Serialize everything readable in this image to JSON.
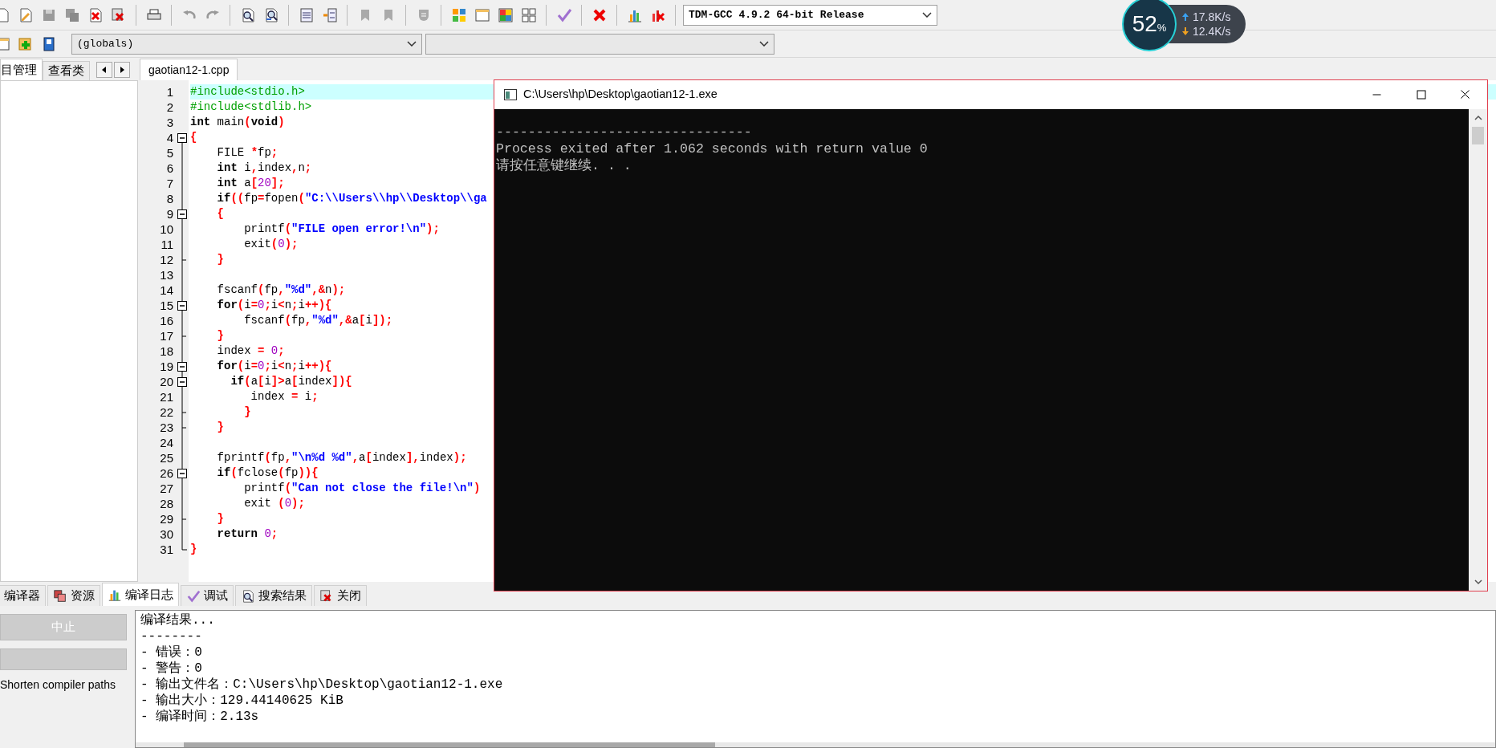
{
  "toolbar": {
    "compiler": "TDM-GCC 4.9.2 64-bit Release",
    "scope": "(globals)"
  },
  "project_panel": {
    "tabs": [
      {
        "label": "目管理",
        "selected": true
      },
      {
        "label": "查看类",
        "selected": false
      }
    ]
  },
  "editor": {
    "tabs": [
      {
        "label": "gaotian12-1.cpp",
        "selected": true
      }
    ],
    "lines": [
      {
        "number": "1",
        "current": true,
        "tokens": [
          {
            "kind": "preprocessor",
            "text": "#include<stdio.h>"
          }
        ]
      },
      {
        "number": "2",
        "current": false,
        "tokens": [
          {
            "kind": "preprocessor",
            "text": "#include<stdlib.h>"
          }
        ]
      },
      {
        "number": "3",
        "current": false,
        "tokens": [
          {
            "kind": "keyword",
            "text": "int"
          },
          {
            "kind": "text",
            "text": " main"
          },
          {
            "kind": "symbol",
            "text": "("
          },
          {
            "kind": "keyword",
            "text": "void"
          },
          {
            "kind": "symbol",
            "text": ")"
          }
        ]
      },
      {
        "number": "4",
        "current": false,
        "kind": "open",
        "tokens": [
          {
            "kind": "symbol",
            "text": "{"
          }
        ]
      },
      {
        "number": "5",
        "current": false,
        "kind": "line",
        "tokens": [
          {
            "kind": "text",
            "text": "    FILE "
          },
          {
            "kind": "symbol",
            "text": "*"
          },
          {
            "kind": "text",
            "text": "fp"
          },
          {
            "kind": "symbol",
            "text": ";"
          }
        ]
      },
      {
        "number": "6",
        "current": false,
        "kind": "line",
        "tokens": [
          {
            "kind": "keyword",
            "text": "    int"
          },
          {
            "kind": "text",
            "text": " i"
          },
          {
            "kind": "symbol",
            "text": ","
          },
          {
            "kind": "text",
            "text": "index"
          },
          {
            "kind": "symbol",
            "text": ","
          },
          {
            "kind": "text",
            "text": "n"
          },
          {
            "kind": "symbol",
            "text": ";"
          }
        ]
      },
      {
        "number": "7",
        "current": false,
        "kind": "line",
        "tokens": [
          {
            "kind": "keyword",
            "text": "    int"
          },
          {
            "kind": "text",
            "text": " a"
          },
          {
            "kind": "symbol",
            "text": "["
          },
          {
            "kind": "number",
            "text": "20"
          },
          {
            "kind": "symbol",
            "text": "];"
          }
        ]
      },
      {
        "number": "8",
        "current": false,
        "kind": "line",
        "tokens": [
          {
            "kind": "keyword",
            "text": "    if"
          },
          {
            "kind": "symbol",
            "text": "(("
          },
          {
            "kind": "text",
            "text": "fp"
          },
          {
            "kind": "symbol",
            "text": "="
          },
          {
            "kind": "text",
            "text": "fopen"
          },
          {
            "kind": "symbol",
            "text": "("
          },
          {
            "kind": "string",
            "text": "\"C:\\\\Users\\\\hp\\\\Desktop\\\\ga"
          }
        ]
      },
      {
        "number": "9",
        "current": false,
        "kind": "open",
        "tokens": [
          {
            "kind": "symbol",
            "text": "    {"
          }
        ]
      },
      {
        "number": "10",
        "current": false,
        "kind": "line",
        "tokens": [
          {
            "kind": "text",
            "text": "        printf"
          },
          {
            "kind": "symbol",
            "text": "("
          },
          {
            "kind": "string",
            "text": "\"FILE open error!\\n\""
          },
          {
            "kind": "symbol",
            "text": ");"
          }
        ]
      },
      {
        "number": "11",
        "current": false,
        "kind": "line",
        "tokens": [
          {
            "kind": "text",
            "text": "        exit"
          },
          {
            "kind": "symbol",
            "text": "("
          },
          {
            "kind": "number",
            "text": "0"
          },
          {
            "kind": "symbol",
            "text": ");"
          }
        ]
      },
      {
        "number": "12",
        "current": false,
        "kind": "end",
        "tokens": [
          {
            "kind": "symbol",
            "text": "    }"
          }
        ]
      },
      {
        "number": "13",
        "current": false,
        "kind": "line"
      },
      {
        "number": "14",
        "current": false,
        "kind": "line",
        "tokens": [
          {
            "kind": "text",
            "text": "    fscanf"
          },
          {
            "kind": "symbol",
            "text": "("
          },
          {
            "kind": "text",
            "text": "fp"
          },
          {
            "kind": "symbol",
            "text": ","
          },
          {
            "kind": "string",
            "text": "\"%d\""
          },
          {
            "kind": "symbol",
            "text": ",&"
          },
          {
            "kind": "text",
            "text": "n"
          },
          {
            "kind": "symbol",
            "text": ");"
          }
        ]
      },
      {
        "number": "15",
        "current": false,
        "kind": "open",
        "tokens": [
          {
            "kind": "keyword",
            "text": "    for"
          },
          {
            "kind": "symbol",
            "text": "("
          },
          {
            "kind": "text",
            "text": "i"
          },
          {
            "kind": "symbol",
            "text": "="
          },
          {
            "kind": "number",
            "text": "0"
          },
          {
            "kind": "symbol",
            "text": ";"
          },
          {
            "kind": "text",
            "text": "i"
          },
          {
            "kind": "symbol",
            "text": "<"
          },
          {
            "kind": "text",
            "text": "n"
          },
          {
            "kind": "symbol",
            "text": ";"
          },
          {
            "kind": "text",
            "text": "i"
          },
          {
            "kind": "symbol",
            "text": "++){"
          }
        ]
      },
      {
        "number": "16",
        "current": false,
        "kind": "line",
        "tokens": [
          {
            "kind": "text",
            "text": "        fscanf"
          },
          {
            "kind": "symbol",
            "text": "("
          },
          {
            "kind": "text",
            "text": "fp"
          },
          {
            "kind": "symbol",
            "text": ","
          },
          {
            "kind": "string",
            "text": "\"%d\""
          },
          {
            "kind": "symbol",
            "text": ",&"
          },
          {
            "kind": "text",
            "text": "a"
          },
          {
            "kind": "symbol",
            "text": "["
          },
          {
            "kind": "text",
            "text": "i"
          },
          {
            "kind": "symbol",
            "text": "]);"
          }
        ]
      },
      {
        "number": "17",
        "current": false,
        "kind": "end",
        "tokens": [
          {
            "kind": "symbol",
            "text": "    }"
          }
        ]
      },
      {
        "number": "18",
        "current": false,
        "kind": "line",
        "tokens": [
          {
            "kind": "text",
            "text": "    index "
          },
          {
            "kind": "symbol",
            "text": "="
          },
          {
            "kind": "number",
            "text": " 0"
          },
          {
            "kind": "symbol",
            "text": ";"
          }
        ]
      },
      {
        "number": "19",
        "current": false,
        "kind": "open",
        "tokens": [
          {
            "kind": "keyword",
            "text": "    for"
          },
          {
            "kind": "symbol",
            "text": "("
          },
          {
            "kind": "text",
            "text": "i"
          },
          {
            "kind": "symbol",
            "text": "="
          },
          {
            "kind": "number",
            "text": "0"
          },
          {
            "kind": "symbol",
            "text": ";"
          },
          {
            "kind": "text",
            "text": "i"
          },
          {
            "kind": "symbol",
            "text": "<"
          },
          {
            "kind": "text",
            "text": "n"
          },
          {
            "kind": "symbol",
            "text": ";"
          },
          {
            "kind": "text",
            "text": "i"
          },
          {
            "kind": "symbol",
            "text": "++){"
          }
        ]
      },
      {
        "number": "20",
        "current": false,
        "kind": "open",
        "tokens": [
          {
            "kind": "keyword",
            "text": "      if"
          },
          {
            "kind": "symbol",
            "text": "("
          },
          {
            "kind": "text",
            "text": "a"
          },
          {
            "kind": "symbol",
            "text": "["
          },
          {
            "kind": "text",
            "text": "i"
          },
          {
            "kind": "symbol",
            "text": "]>"
          },
          {
            "kind": "text",
            "text": "a"
          },
          {
            "kind": "symbol",
            "text": "["
          },
          {
            "kind": "text",
            "text": "index"
          },
          {
            "kind": "symbol",
            "text": "]){"
          }
        ]
      },
      {
        "number": "21",
        "current": false,
        "kind": "line",
        "tokens": [
          {
            "kind": "text",
            "text": "         index "
          },
          {
            "kind": "symbol",
            "text": "="
          },
          {
            "kind": "text",
            "text": " i"
          },
          {
            "kind": "symbol",
            "text": ";"
          }
        ]
      },
      {
        "number": "22",
        "current": false,
        "kind": "end",
        "tokens": [
          {
            "kind": "symbol",
            "text": "        }"
          }
        ]
      },
      {
        "number": "23",
        "current": false,
        "kind": "end",
        "tokens": [
          {
            "kind": "symbol",
            "text": "    }"
          }
        ]
      },
      {
        "number": "24",
        "current": false,
        "kind": "line"
      },
      {
        "number": "25",
        "current": false,
        "kind": "line",
        "tokens": [
          {
            "kind": "text",
            "text": "    fprintf"
          },
          {
            "kind": "symbol",
            "text": "("
          },
          {
            "kind": "text",
            "text": "fp"
          },
          {
            "kind": "symbol",
            "text": ","
          },
          {
            "kind": "string",
            "text": "\"\\n%d %d\""
          },
          {
            "kind": "symbol",
            "text": ","
          },
          {
            "kind": "text",
            "text": "a"
          },
          {
            "kind": "symbol",
            "text": "["
          },
          {
            "kind": "text",
            "text": "index"
          },
          {
            "kind": "symbol",
            "text": "],"
          },
          {
            "kind": "text",
            "text": "index"
          },
          {
            "kind": "symbol",
            "text": ");"
          }
        ]
      },
      {
        "number": "26",
        "current": false,
        "kind": "open",
        "tokens": [
          {
            "kind": "keyword",
            "text": "    if"
          },
          {
            "kind": "symbol",
            "text": "("
          },
          {
            "kind": "text",
            "text": "fclose"
          },
          {
            "kind": "symbol",
            "text": "("
          },
          {
            "kind": "text",
            "text": "fp"
          },
          {
            "kind": "symbol",
            "text": ")){"
          }
        ]
      },
      {
        "number": "27",
        "current": false,
        "kind": "line",
        "tokens": [
          {
            "kind": "text",
            "text": "        printf"
          },
          {
            "kind": "symbol",
            "text": "("
          },
          {
            "kind": "string",
            "text": "\"Can not close the file!\\n\""
          },
          {
            "kind": "symbol",
            "text": ")"
          }
        ]
      },
      {
        "number": "28",
        "current": false,
        "kind": "line",
        "tokens": [
          {
            "kind": "text",
            "text": "        exit "
          },
          {
            "kind": "symbol",
            "text": "("
          },
          {
            "kind": "number",
            "text": "0"
          },
          {
            "kind": "symbol",
            "text": ");"
          }
        ]
      },
      {
        "number": "29",
        "current": false,
        "kind": "end",
        "tokens": [
          {
            "kind": "symbol",
            "text": "    }"
          }
        ]
      },
      {
        "number": "30",
        "current": false,
        "kind": "line",
        "tokens": [
          {
            "kind": "keyword",
            "text": "    return"
          },
          {
            "kind": "number",
            "text": " 0"
          },
          {
            "kind": "symbol",
            "text": ";"
          }
        ]
      },
      {
        "number": "31",
        "current": false,
        "kind": "last",
        "tokens": [
          {
            "kind": "symbol",
            "text": "}"
          }
        ]
      }
    ]
  },
  "console": {
    "title": "C:\\Users\\hp\\Desktop\\gaotian12-1.exe",
    "lines": [
      "--------------------------------",
      "Process exited after 1.062 seconds with return value 0",
      "请按任意键继续. . ."
    ]
  },
  "bottom_panel": {
    "tabs": [
      {
        "label": "编译器",
        "selected": false
      },
      {
        "label": "资源",
        "selected": false
      },
      {
        "label": "编译日志",
        "selected": true
      },
      {
        "label": "调试",
        "selected": false
      },
      {
        "label": "搜索结果",
        "selected": false
      },
      {
        "label": "关闭",
        "selected": false
      }
    ],
    "abort_button": {
      "label": "中止",
      "disabled": true
    },
    "shorten_paths_label": "Shorten compiler paths",
    "log": [
      "编译结果...",
      "--------",
      "- 错误：0",
      "- 警告：0",
      "- 输出文件名：C:\\Users\\hp\\Desktop\\gaotian12-1.exe",
      "- 输出大小：129.44140625 KiB",
      "- 编译时间：2.13s"
    ]
  },
  "network_monitor": {
    "usage": "52",
    "unit": "%",
    "upload": "17.8K/s",
    "download": "12.4K/s"
  }
}
